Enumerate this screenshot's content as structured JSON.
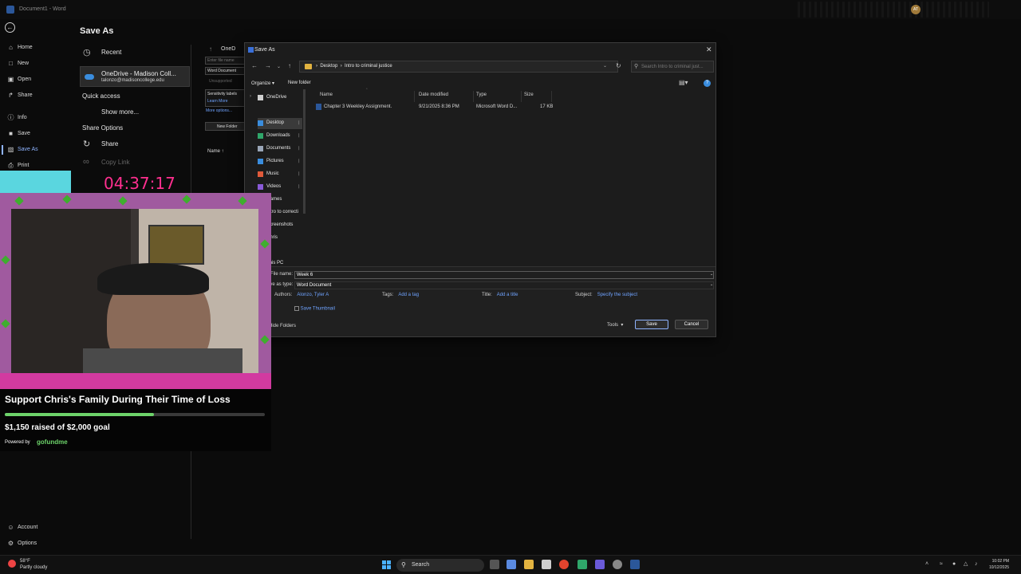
{
  "window": {
    "title": "Document1 - Word",
    "avatar_initials": "AT"
  },
  "nav": {
    "items": [
      {
        "label": "Home",
        "icon": "home-icon"
      },
      {
        "label": "New",
        "icon": "new-document-icon"
      },
      {
        "label": "Open",
        "icon": "folder-open-icon"
      },
      {
        "label": "Share",
        "icon": "share-icon"
      },
      {
        "label": "Info",
        "icon": "info-icon"
      },
      {
        "label": "Save",
        "icon": "save-icon"
      },
      {
        "label": "Save As",
        "icon": "save-as-icon",
        "active": true
      },
      {
        "label": "Print",
        "icon": "print-icon"
      }
    ],
    "bottom": [
      {
        "label": "Account",
        "icon": "account-icon"
      },
      {
        "label": "Options",
        "icon": "options-icon"
      }
    ]
  },
  "saveas": {
    "title": "Save As",
    "recent": "Recent",
    "onedrive_name": "OneDrive - Madison Coll...",
    "onedrive_email": "talonzo@madisoncollege.edu",
    "quick_access": "Quick access",
    "show_more": "Show more...",
    "share_options": "Share Options",
    "share": "Share",
    "copy_link": "Copy Link"
  },
  "middle": {
    "location_short": "OneD",
    "filename_placeholder": "Enter file name",
    "type": "Word Document",
    "unsupported": "Unsupported",
    "sensitivity": "Sensitivity labels",
    "learn_more": "Learn More",
    "more_options": "More options...",
    "new_folder": "New Folder",
    "name_header": "Name ↑"
  },
  "dialog": {
    "title": "Save As",
    "breadcrumb": [
      "Desktop",
      "Intro to criminal justice"
    ],
    "search_placeholder": "Search Intro to criminal just...",
    "organize": "Organize ▾",
    "new_folder": "New folder",
    "tree": [
      {
        "label": "OneDrive",
        "icon_color": "#cfcfcf"
      },
      {
        "label": "Desktop",
        "icon_color": "#3a8dde",
        "pinned": true
      },
      {
        "label": "Downloads",
        "icon_color": "#2fa66a",
        "pinned": true
      },
      {
        "label": "Documents",
        "icon_color": "#9aa6b8",
        "pinned": true
      },
      {
        "label": "Pictures",
        "icon_color": "#3a8dde",
        "pinned": true
      },
      {
        "label": "Music",
        "icon_color": "#e05a3a",
        "pinned": true
      },
      {
        "label": "Videos",
        "icon_color": "#8a5ad8",
        "pinned": true
      },
      {
        "label": "Games",
        "icon_color": "#e2b340"
      },
      {
        "label": "Intro to correcti",
        "icon_color": "#e2b340"
      },
      {
        "label": "Screenshots",
        "icon_color": "#e2b340"
      },
      {
        "label": "Chris",
        "icon_color": "#e2b340"
      },
      {
        "label": "This PC",
        "icon_color": "#3a8dde"
      }
    ],
    "columns": [
      "Name",
      "Date modified",
      "Type",
      "Size"
    ],
    "files": [
      {
        "name": "Chapter 3 Weekley Assignment.",
        "date": "9/21/2025 8:36 PM",
        "type": "Microsoft Word D...",
        "size": "17 KB"
      }
    ],
    "file_name_label": "File name:",
    "file_name_value": "Week 6",
    "save_type_label": "Save as type:",
    "save_type_value": "Word Document",
    "authors_label": "Authors:",
    "authors_value": "Alonzo, Tyler A",
    "tags_label": "Tags:",
    "tags_value": "Add a tag",
    "title_label": "Title:",
    "title_value": "Add a title",
    "subject_label": "Subject:",
    "subject_value": "Specify the subject",
    "thumbnail": "Save Thumbnail",
    "hide_folders": "Hide Folders",
    "tools": "Tools",
    "save": "Save",
    "cancel": "Cancel"
  },
  "stream": {
    "timer": "04:37:17",
    "fundraiser_title": "Support Chris's Family During Their Time of Loss",
    "raised": "$1,150 raised of $2,000 goal",
    "progress": 0.575,
    "powered_by": "Powered by",
    "brand": "gofundme"
  },
  "taskbar": {
    "temp": "58°F",
    "condition": "Partly cloudy",
    "search": "Search",
    "time": "10:02 PM",
    "date": "10/12/2025"
  }
}
